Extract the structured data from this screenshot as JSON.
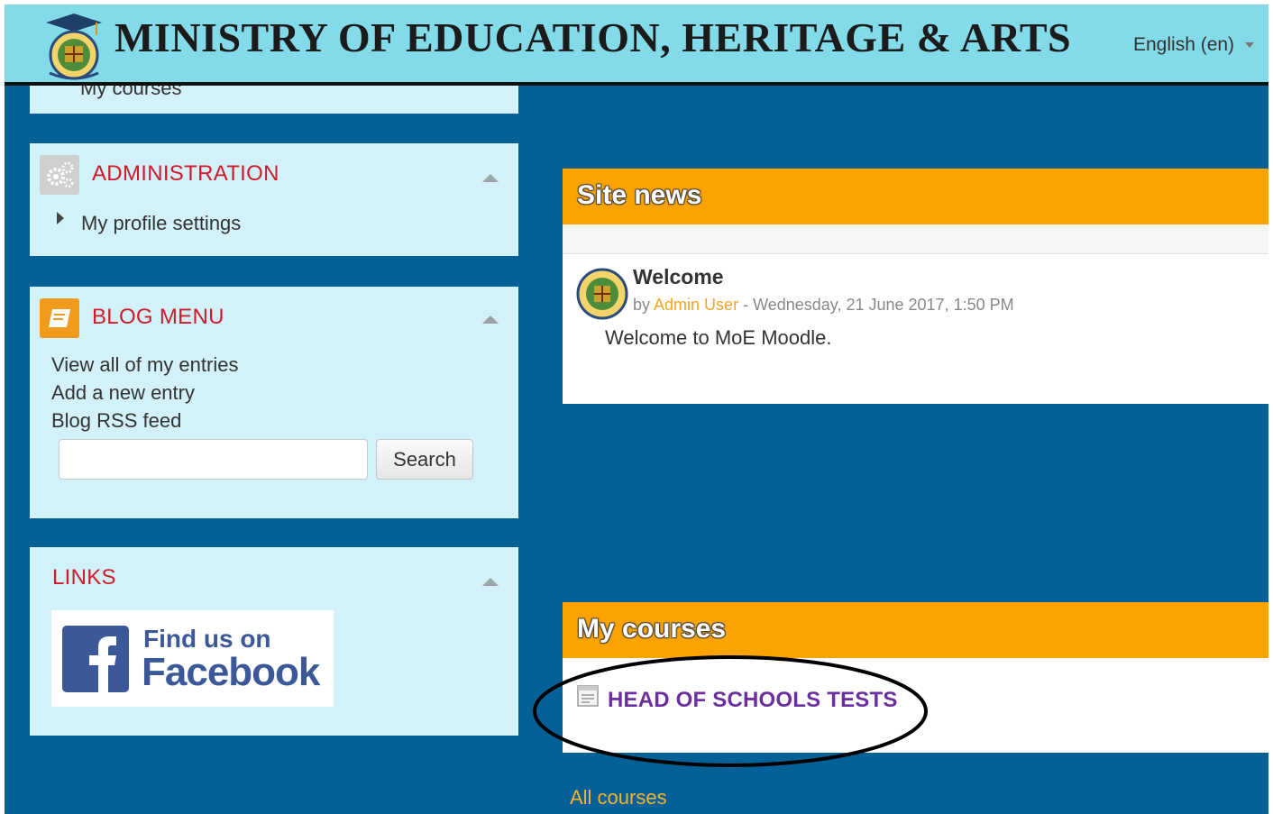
{
  "header": {
    "title": "MINISTRY OF EDUCATION, HERITAGE & ARTS",
    "language": "English (en)",
    "logo_icon": "ministry-crest-icon"
  },
  "sidebar": {
    "top_block": {
      "partial_link": "My courses"
    },
    "administration": {
      "title": "ADMINISTRATION",
      "icon": "gears-icon",
      "items": [
        {
          "label": "My profile settings"
        }
      ]
    },
    "blog_menu": {
      "title": "BLOG MENU",
      "icon": "book-icon",
      "links": [
        {
          "label": "View all of my entries"
        },
        {
          "label": "Add a new entry"
        },
        {
          "label": "Blog RSS feed"
        }
      ],
      "search": {
        "value": "",
        "button_label": "Search"
      }
    },
    "links": {
      "title": "LINKS",
      "facebook": {
        "line1": "Find us on",
        "line2": "Facebook"
      }
    }
  },
  "main": {
    "site_news": {
      "title": "Site news",
      "post": {
        "subject": "Welcome",
        "by": "by",
        "author": "Admin User",
        "date": "- Wednesday, 21 June 2017, 1:50 PM",
        "message": "Welcome to MoE Moodle."
      }
    },
    "my_courses": {
      "title": "My courses",
      "courses": [
        {
          "name": "HEAD OF SCHOOLS TESTS"
        }
      ],
      "all_courses_label": "All courses"
    }
  },
  "colors": {
    "page_background": "#036198",
    "header_background": "#83dbea",
    "block_background": "#d3f1f8",
    "block_title": "#d01a2b",
    "panel_header": "#fda301",
    "course_link": "#6b2fa0",
    "all_courses_link": "#f5b32b"
  }
}
